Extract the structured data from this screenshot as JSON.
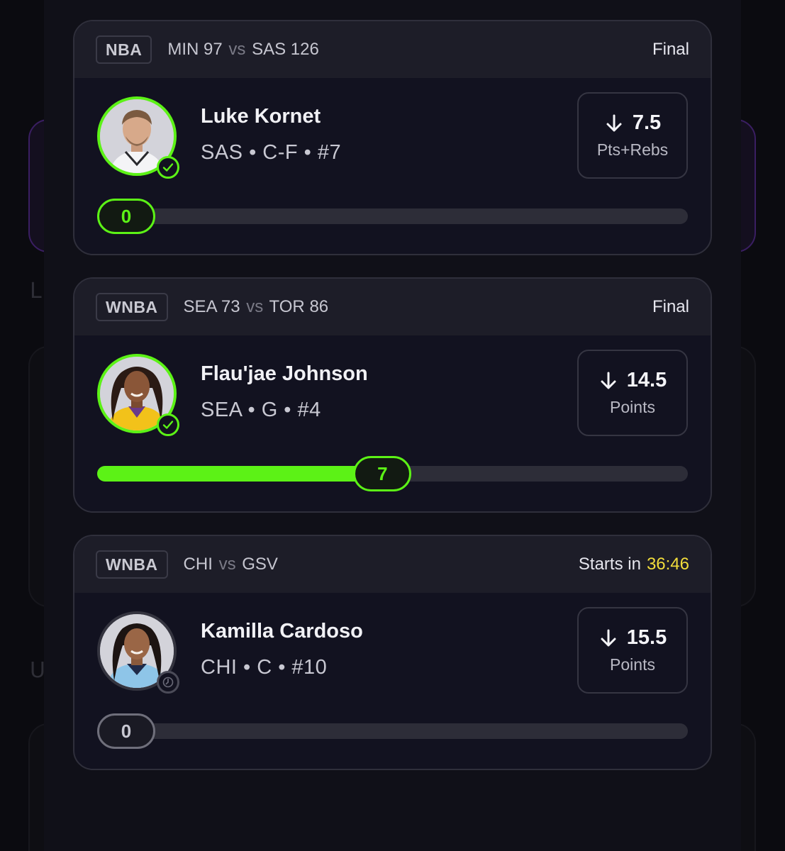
{
  "background": {
    "letters": [
      "L",
      "U"
    ]
  },
  "colors": {
    "accent_green": "#5cf216",
    "countdown_yellow": "#f2dd3b",
    "card_bg": "#121220",
    "header_bg": "#1d1d28"
  },
  "cards": [
    {
      "league": "NBA",
      "team1": "MIN",
      "score1": "97",
      "vs": "vs",
      "team2": "SAS",
      "score2": "126",
      "status": "Final",
      "player_name": "Luke Kornet",
      "player_meta": "SAS • C-F • #7",
      "line_direction_icon": "arrow-down-icon",
      "line_value": "7.5",
      "line_stat": "Pts+Rebs",
      "progress_value": "0",
      "progress_fraction": 0,
      "state": "final",
      "status_icon": "check-icon"
    },
    {
      "league": "WNBA",
      "team1": "SEA",
      "score1": "73",
      "vs": "vs",
      "team2": "TOR",
      "score2": "86",
      "status": "Final",
      "player_name": "Flau'jae Johnson",
      "player_meta": "SEA • G • #4",
      "line_direction_icon": "arrow-down-icon",
      "line_value": "14.5",
      "line_stat": "Points",
      "progress_value": "7",
      "progress_fraction": 0.483,
      "state": "final",
      "status_icon": "check-icon"
    },
    {
      "league": "WNBA",
      "team1": "CHI",
      "score1": "",
      "vs": "vs",
      "team2": "GSV",
      "score2": "",
      "status": "Starts in",
      "countdown": "36:46",
      "player_name": "Kamilla Cardoso",
      "player_meta": "CHI • C • #10",
      "line_direction_icon": "arrow-down-icon",
      "line_value": "15.5",
      "line_stat": "Points",
      "progress_value": "0",
      "progress_fraction": 0,
      "state": "pending",
      "status_icon": "clock-icon"
    }
  ]
}
